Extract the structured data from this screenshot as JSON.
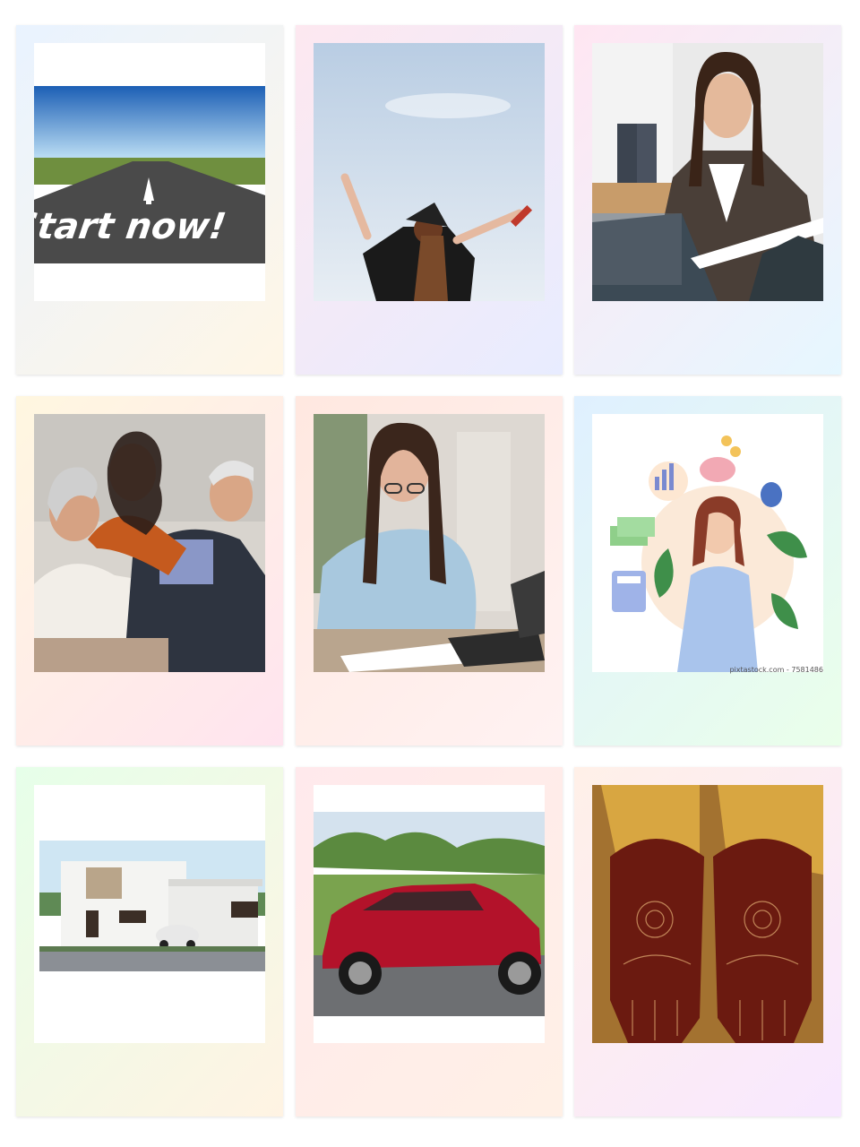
{
  "cards": [
    {
      "id": "start-now",
      "caption_text": "Start now!",
      "gradient": [
        "#e9f3ff",
        "#fff6e6"
      ]
    },
    {
      "id": "graduation",
      "gradient": [
        "#fde8f0",
        "#e8ecff"
      ]
    },
    {
      "id": "job-interview",
      "gradient": [
        "#ffe6f2",
        "#e6f7ff"
      ]
    },
    {
      "id": "family-retirement",
      "gradient": [
        "#fff7e0",
        "#ffe4ef"
      ]
    },
    {
      "id": "woman-studying",
      "gradient": [
        "#ffe8e0",
        "#fff2f2"
      ]
    },
    {
      "id": "savings-illustration",
      "watermark": "pixtastock.com - 7581486",
      "gradient": [
        "#dff0ff",
        "#eaffea"
      ]
    },
    {
      "id": "house",
      "gradient": [
        "#e6ffe9",
        "#fff3e3"
      ]
    },
    {
      "id": "red-car",
      "gradient": [
        "#ffe9ec",
        "#fff0e6"
      ]
    },
    {
      "id": "henna-hands",
      "gradient": [
        "#fff0e8",
        "#f8e8ff"
      ]
    }
  ],
  "colors": {
    "asphalt": "#4a4a4a",
    "sky": "#2b74c8",
    "car_red": "#b3122a",
    "henna": "#6b1a10"
  }
}
